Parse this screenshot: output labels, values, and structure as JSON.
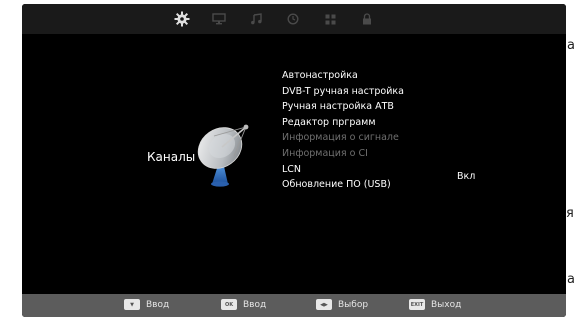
{
  "side_fragments": [
    "а",
    "я",
    "а"
  ],
  "top_icons": [
    {
      "name": "gear-icon",
      "active": true
    },
    {
      "name": "monitor-icon",
      "active": false
    },
    {
      "name": "music-note-icon",
      "active": false
    },
    {
      "name": "clock-icon",
      "active": false
    },
    {
      "name": "grid-icon",
      "active": false
    },
    {
      "name": "lock-icon",
      "active": false
    }
  ],
  "menu": {
    "title": "Каналы",
    "icon": "satellite-dish-icon",
    "items": [
      {
        "label": "Автонастройка",
        "enabled": true
      },
      {
        "label": "DVB-T ручная настройка",
        "enabled": true
      },
      {
        "label": "Ручная настройка АТВ",
        "enabled": true
      },
      {
        "label": "Редактор прграмм",
        "enabled": true
      },
      {
        "label": "Информация о сигнале",
        "enabled": false
      },
      {
        "label": "Информация о CI",
        "enabled": false
      },
      {
        "label": "LCN",
        "enabled": true,
        "value": "Вкл"
      },
      {
        "label": "Обновление ПО (USB)",
        "enabled": true
      }
    ]
  },
  "bottom_hints": [
    {
      "key": "▼",
      "label": "Ввод"
    },
    {
      "key": "OK",
      "label": "Ввод"
    },
    {
      "key": "◀▶",
      "label": "Выбор"
    },
    {
      "key": "EXIT",
      "label": "Выход"
    }
  ],
  "colors": {
    "screen_bg": "#000000",
    "top_bar": "#1a1a1a",
    "bottom_bar": "#5c5c5c",
    "text": "#ffffff",
    "disabled_text": "#6f6f6f",
    "active_icon": "#e0e0e0",
    "inactive_icon": "#4a4a4a"
  }
}
